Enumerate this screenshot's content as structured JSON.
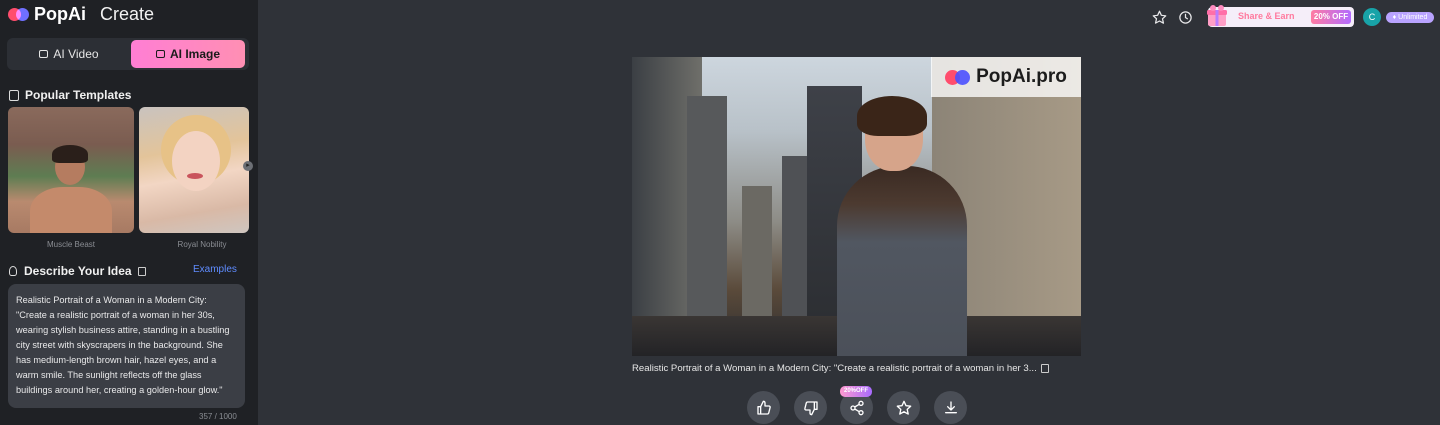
{
  "brand": {
    "name": "PopAi",
    "section": "Create"
  },
  "modes": {
    "video_label": "AI Video",
    "image_label": "AI Image"
  },
  "templates": {
    "heading": "Popular Templates",
    "items": [
      {
        "label": "Muscle Beast"
      },
      {
        "label": "Royal Nobility"
      }
    ]
  },
  "describe": {
    "heading": "Describe Your Idea",
    "examples_label": "Examples",
    "prompt_text": "Realistic Portrait of a Woman in a Modern City:\n\"Create a realistic portrait of a woman in her 30s, wearing stylish business attire, standing in a bustling city street with skyscrapers in the background. She has medium-length brown hair, hazel eyes, and a warm smile. The sunlight reflects off the glass buildings around her, creating a golden-hour glow.\"",
    "counter": "357 / 1000"
  },
  "topbar": {
    "share_label": "Share & Earn",
    "share_badge": "20% OFF",
    "avatar_initial": "C",
    "plan_label": "Unlimited"
  },
  "result": {
    "watermark": "PopAi.pro",
    "caption": "Realistic Portrait of a Woman in a Modern City: \"Create a realistic portrait of a woman in her 3...",
    "promo_badge": "20%OFF"
  },
  "colors": {
    "accent_pink": "#ff7ed4",
    "link_blue": "#5f8cff",
    "sidebar_bg": "#1f2125",
    "main_bg": "#2f3238"
  },
  "icons": {
    "actions": [
      "thumbs-up-icon",
      "thumbs-down-icon",
      "share-icon",
      "star-icon",
      "download-icon"
    ],
    "topbar": [
      "star-icon",
      "history-icon",
      "gift-icon"
    ]
  }
}
